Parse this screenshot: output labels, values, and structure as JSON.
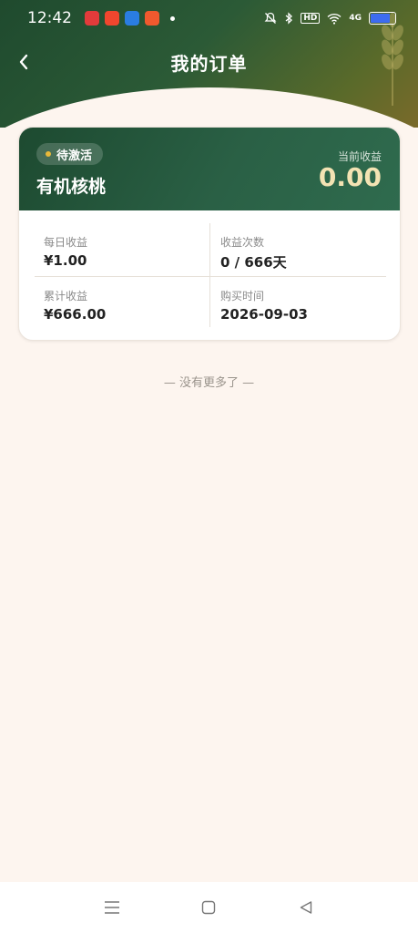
{
  "status_bar": {
    "time": "12:42",
    "hd": "HD",
    "signal": "4G"
  },
  "colors": {
    "header_start": "#1f4a2e",
    "card_top": "#2a6045",
    "badge_dot": "#e8b83a",
    "earn_value": "#f3e3b3",
    "page_bg": "#fdf5ef",
    "battery": "#3d6cf0"
  },
  "nav": {
    "title": "我的订单",
    "back_icon": "chevron-left-icon"
  },
  "order": {
    "status": "待激活",
    "product": "有机核桃",
    "earn_label": "当前收益",
    "earn_value": "0.00",
    "daily_label": "每日收益",
    "daily_value": "¥1.00",
    "count_label": "收益次数",
    "count_value": "0 / 666天",
    "total_label": "累计收益",
    "total_value": "¥666.00",
    "date_label": "购买时间",
    "date_value": "2026-09-03"
  },
  "list_footer": "— 没有更多了 —",
  "system_nav": {
    "menu_icon": "menu-icon",
    "home_icon": "square-icon",
    "back_icon": "triangle-back-icon"
  }
}
